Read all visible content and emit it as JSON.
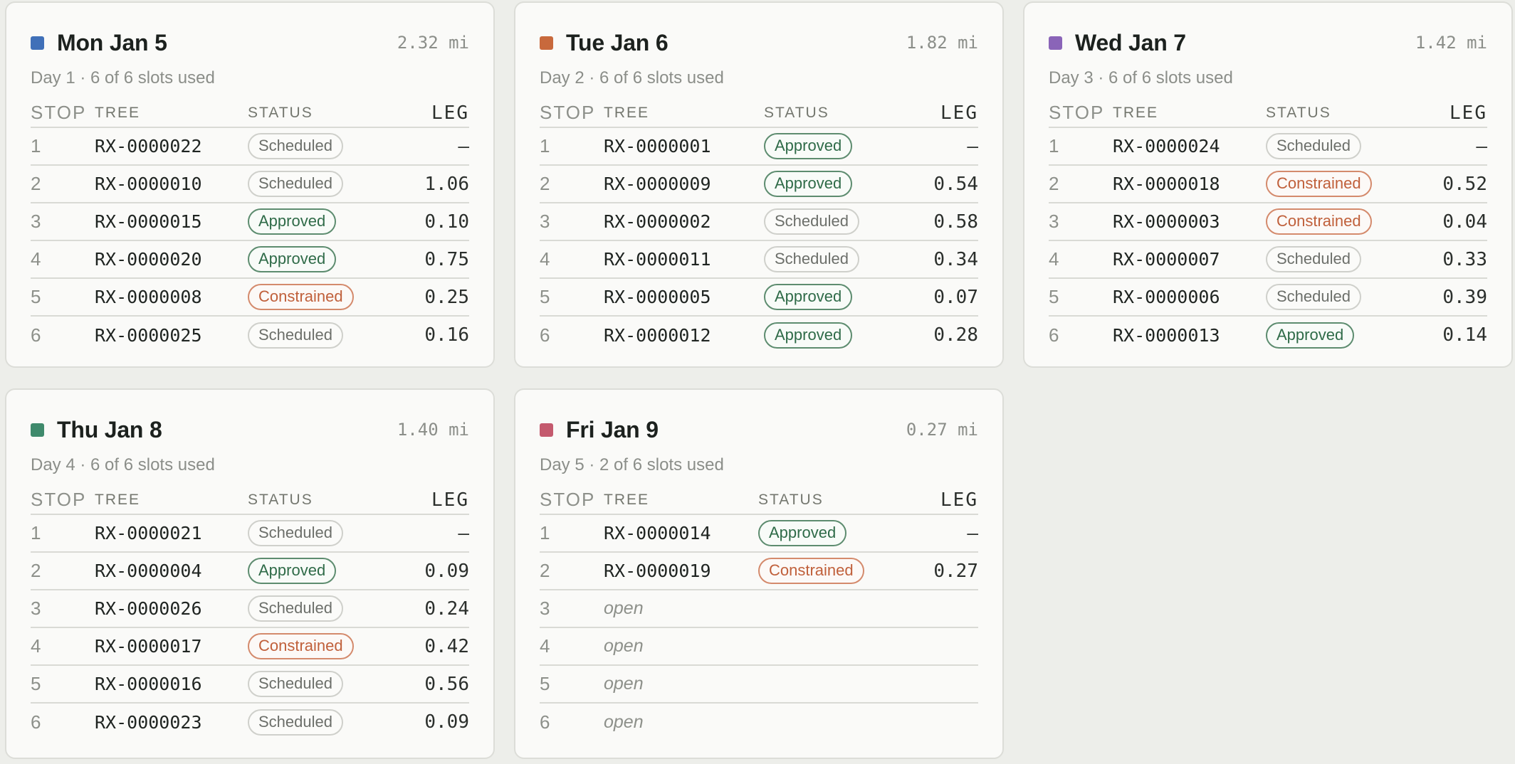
{
  "days": [
    {
      "title": "Mon Jan 5",
      "distance": "2.32 mi",
      "subtitle": "Day 1 · 6 of 6 slots used",
      "color": "#4070b8",
      "headers": {
        "stop": "STOP",
        "tree": "TREE",
        "status": "STATUS",
        "leg": "LEG"
      },
      "rows": [
        {
          "stop": "1",
          "tree": "RX-0000022",
          "status": "Scheduled",
          "kind": "scheduled",
          "leg": "—"
        },
        {
          "stop": "2",
          "tree": "RX-0000010",
          "status": "Scheduled",
          "kind": "scheduled",
          "leg": "1.06"
        },
        {
          "stop": "3",
          "tree": "RX-0000015",
          "status": "Approved",
          "kind": "approved",
          "leg": "0.10"
        },
        {
          "stop": "4",
          "tree": "RX-0000020",
          "status": "Approved",
          "kind": "approved",
          "leg": "0.75"
        },
        {
          "stop": "5",
          "tree": "RX-0000008",
          "status": "Constrained",
          "kind": "constrained",
          "leg": "0.25"
        },
        {
          "stop": "6",
          "tree": "RX-0000025",
          "status": "Scheduled",
          "kind": "scheduled",
          "leg": "0.16"
        }
      ]
    },
    {
      "title": "Tue Jan 6",
      "distance": "1.82 mi",
      "subtitle": "Day 2 · 6 of 6 slots used",
      "color": "#c8693c",
      "headers": {
        "stop": "STOP",
        "tree": "TREE",
        "status": "STATUS",
        "leg": "LEG"
      },
      "rows": [
        {
          "stop": "1",
          "tree": "RX-0000001",
          "status": "Approved",
          "kind": "approved",
          "leg": "—"
        },
        {
          "stop": "2",
          "tree": "RX-0000009",
          "status": "Approved",
          "kind": "approved",
          "leg": "0.54"
        },
        {
          "stop": "3",
          "tree": "RX-0000002",
          "status": "Scheduled",
          "kind": "scheduled",
          "leg": "0.58"
        },
        {
          "stop": "4",
          "tree": "RX-0000011",
          "status": "Scheduled",
          "kind": "scheduled",
          "leg": "0.34"
        },
        {
          "stop": "5",
          "tree": "RX-0000005",
          "status": "Approved",
          "kind": "approved",
          "leg": "0.07"
        },
        {
          "stop": "6",
          "tree": "RX-0000012",
          "status": "Approved",
          "kind": "approved",
          "leg": "0.28"
        }
      ]
    },
    {
      "title": "Wed Jan 7",
      "distance": "1.42 mi",
      "subtitle": "Day 3 · 6 of 6 slots used",
      "color": "#8a64b8",
      "headers": {
        "stop": "STOP",
        "tree": "TREE",
        "status": "STATUS",
        "leg": "LEG"
      },
      "rows": [
        {
          "stop": "1",
          "tree": "RX-0000024",
          "status": "Scheduled",
          "kind": "scheduled",
          "leg": "—"
        },
        {
          "stop": "2",
          "tree": "RX-0000018",
          "status": "Constrained",
          "kind": "constrained",
          "leg": "0.52"
        },
        {
          "stop": "3",
          "tree": "RX-0000003",
          "status": "Constrained",
          "kind": "constrained",
          "leg": "0.04"
        },
        {
          "stop": "4",
          "tree": "RX-0000007",
          "status": "Scheduled",
          "kind": "scheduled",
          "leg": "0.33"
        },
        {
          "stop": "5",
          "tree": "RX-0000006",
          "status": "Scheduled",
          "kind": "scheduled",
          "leg": "0.39"
        },
        {
          "stop": "6",
          "tree": "RX-0000013",
          "status": "Approved",
          "kind": "approved",
          "leg": "0.14"
        }
      ]
    },
    {
      "title": "Thu Jan 8",
      "distance": "1.40 mi",
      "subtitle": "Day 4 · 6 of 6 slots used",
      "color": "#3f8a6c",
      "headers": {
        "stop": "STOP",
        "tree": "TREE",
        "status": "STATUS",
        "leg": "LEG"
      },
      "rows": [
        {
          "stop": "1",
          "tree": "RX-0000021",
          "status": "Scheduled",
          "kind": "scheduled",
          "leg": "—"
        },
        {
          "stop": "2",
          "tree": "RX-0000004",
          "status": "Approved",
          "kind": "approved",
          "leg": "0.09"
        },
        {
          "stop": "3",
          "tree": "RX-0000026",
          "status": "Scheduled",
          "kind": "scheduled",
          "leg": "0.24"
        },
        {
          "stop": "4",
          "tree": "RX-0000017",
          "status": "Constrained",
          "kind": "constrained",
          "leg": "0.42"
        },
        {
          "stop": "5",
          "tree": "RX-0000016",
          "status": "Scheduled",
          "kind": "scheduled",
          "leg": "0.56"
        },
        {
          "stop": "6",
          "tree": "RX-0000023",
          "status": "Scheduled",
          "kind": "scheduled",
          "leg": "0.09"
        }
      ]
    },
    {
      "title": "Fri Jan 9",
      "distance": "0.27 mi",
      "subtitle": "Day 5 · 2 of 6 slots used",
      "color": "#c45a6e",
      "headers": {
        "stop": "STOP",
        "tree": "TREE",
        "status": "STATUS",
        "leg": "LEG"
      },
      "rows": [
        {
          "stop": "1",
          "tree": "RX-0000014",
          "status": "Approved",
          "kind": "approved",
          "leg": "—"
        },
        {
          "stop": "2",
          "tree": "RX-0000019",
          "status": "Constrained",
          "kind": "constrained",
          "leg": "0.27"
        },
        {
          "stop": "3",
          "tree": "open",
          "kind": "open"
        },
        {
          "stop": "4",
          "tree": "open",
          "kind": "open"
        },
        {
          "stop": "5",
          "tree": "open",
          "kind": "open"
        },
        {
          "stop": "6",
          "tree": "open",
          "kind": "open"
        }
      ]
    }
  ]
}
